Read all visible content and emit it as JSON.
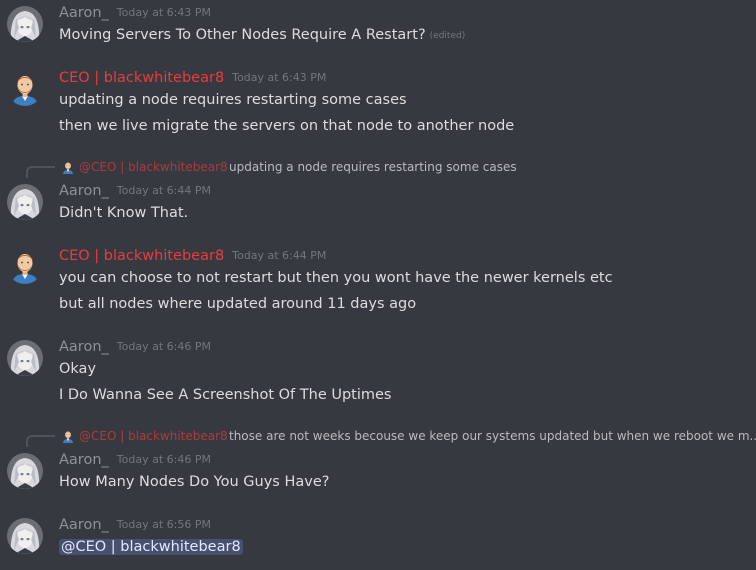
{
  "users": {
    "aaron": {
      "name": "Aaron_",
      "color": "#8e9297"
    },
    "ceo": {
      "name": "CEO | blackwhitebear8",
      "color": "#ec3b3b"
    }
  },
  "messages": [
    {
      "author": "Aaron_",
      "timestamp": "Today at 6:43 PM",
      "text": "Moving Servers To Other Nodes Require A Restart?",
      "edited_label": "(edited)"
    },
    {
      "author": "CEO | blackwhitebear8",
      "timestamp": "Today at 6:43 PM",
      "lines": [
        "updating a node requires restarting some cases",
        "then we live migrate the servers on that node to another node"
      ]
    },
    {
      "reply_to": {
        "author": "@CEO | blackwhitebear8",
        "text": "updating a node requires restarting some cases"
      },
      "author": "Aaron_",
      "timestamp": "Today at 6:44 PM",
      "text": "Didn't Know That."
    },
    {
      "author": "CEO | blackwhitebear8",
      "timestamp": "Today at 6:44 PM",
      "lines": [
        "you can choose to not restart but then you wont have the newer kernels etc",
        "but all nodes where updated around 11 days ago"
      ]
    },
    {
      "author": "Aaron_",
      "timestamp": "Today at 6:46 PM",
      "lines": [
        "Okay",
        "I Do Wanna See A Screenshot Of The Uptimes"
      ]
    },
    {
      "reply_to": {
        "author": "@CEO | blackwhitebear8",
        "text": "those are not weeks becouse we keep our systems updated but when we reboot we m..."
      },
      "author": "Aaron_",
      "timestamp": "Today at 6:46 PM",
      "text": "How Many Nodes Do You Guys Have?"
    },
    {
      "author": "Aaron_",
      "timestamp": "Today at 6:56 PM",
      "mention": "@CEO | blackwhitebear8"
    }
  ],
  "colors": {
    "background": "#36393f",
    "message_text": "#dcddde",
    "timestamp": "#72767d",
    "mention_bg": "#4b5585"
  },
  "icons": {
    "aaron_avatar": "anime-silver-hair-avatar",
    "ceo_avatar": "bearded-man-avatar"
  }
}
